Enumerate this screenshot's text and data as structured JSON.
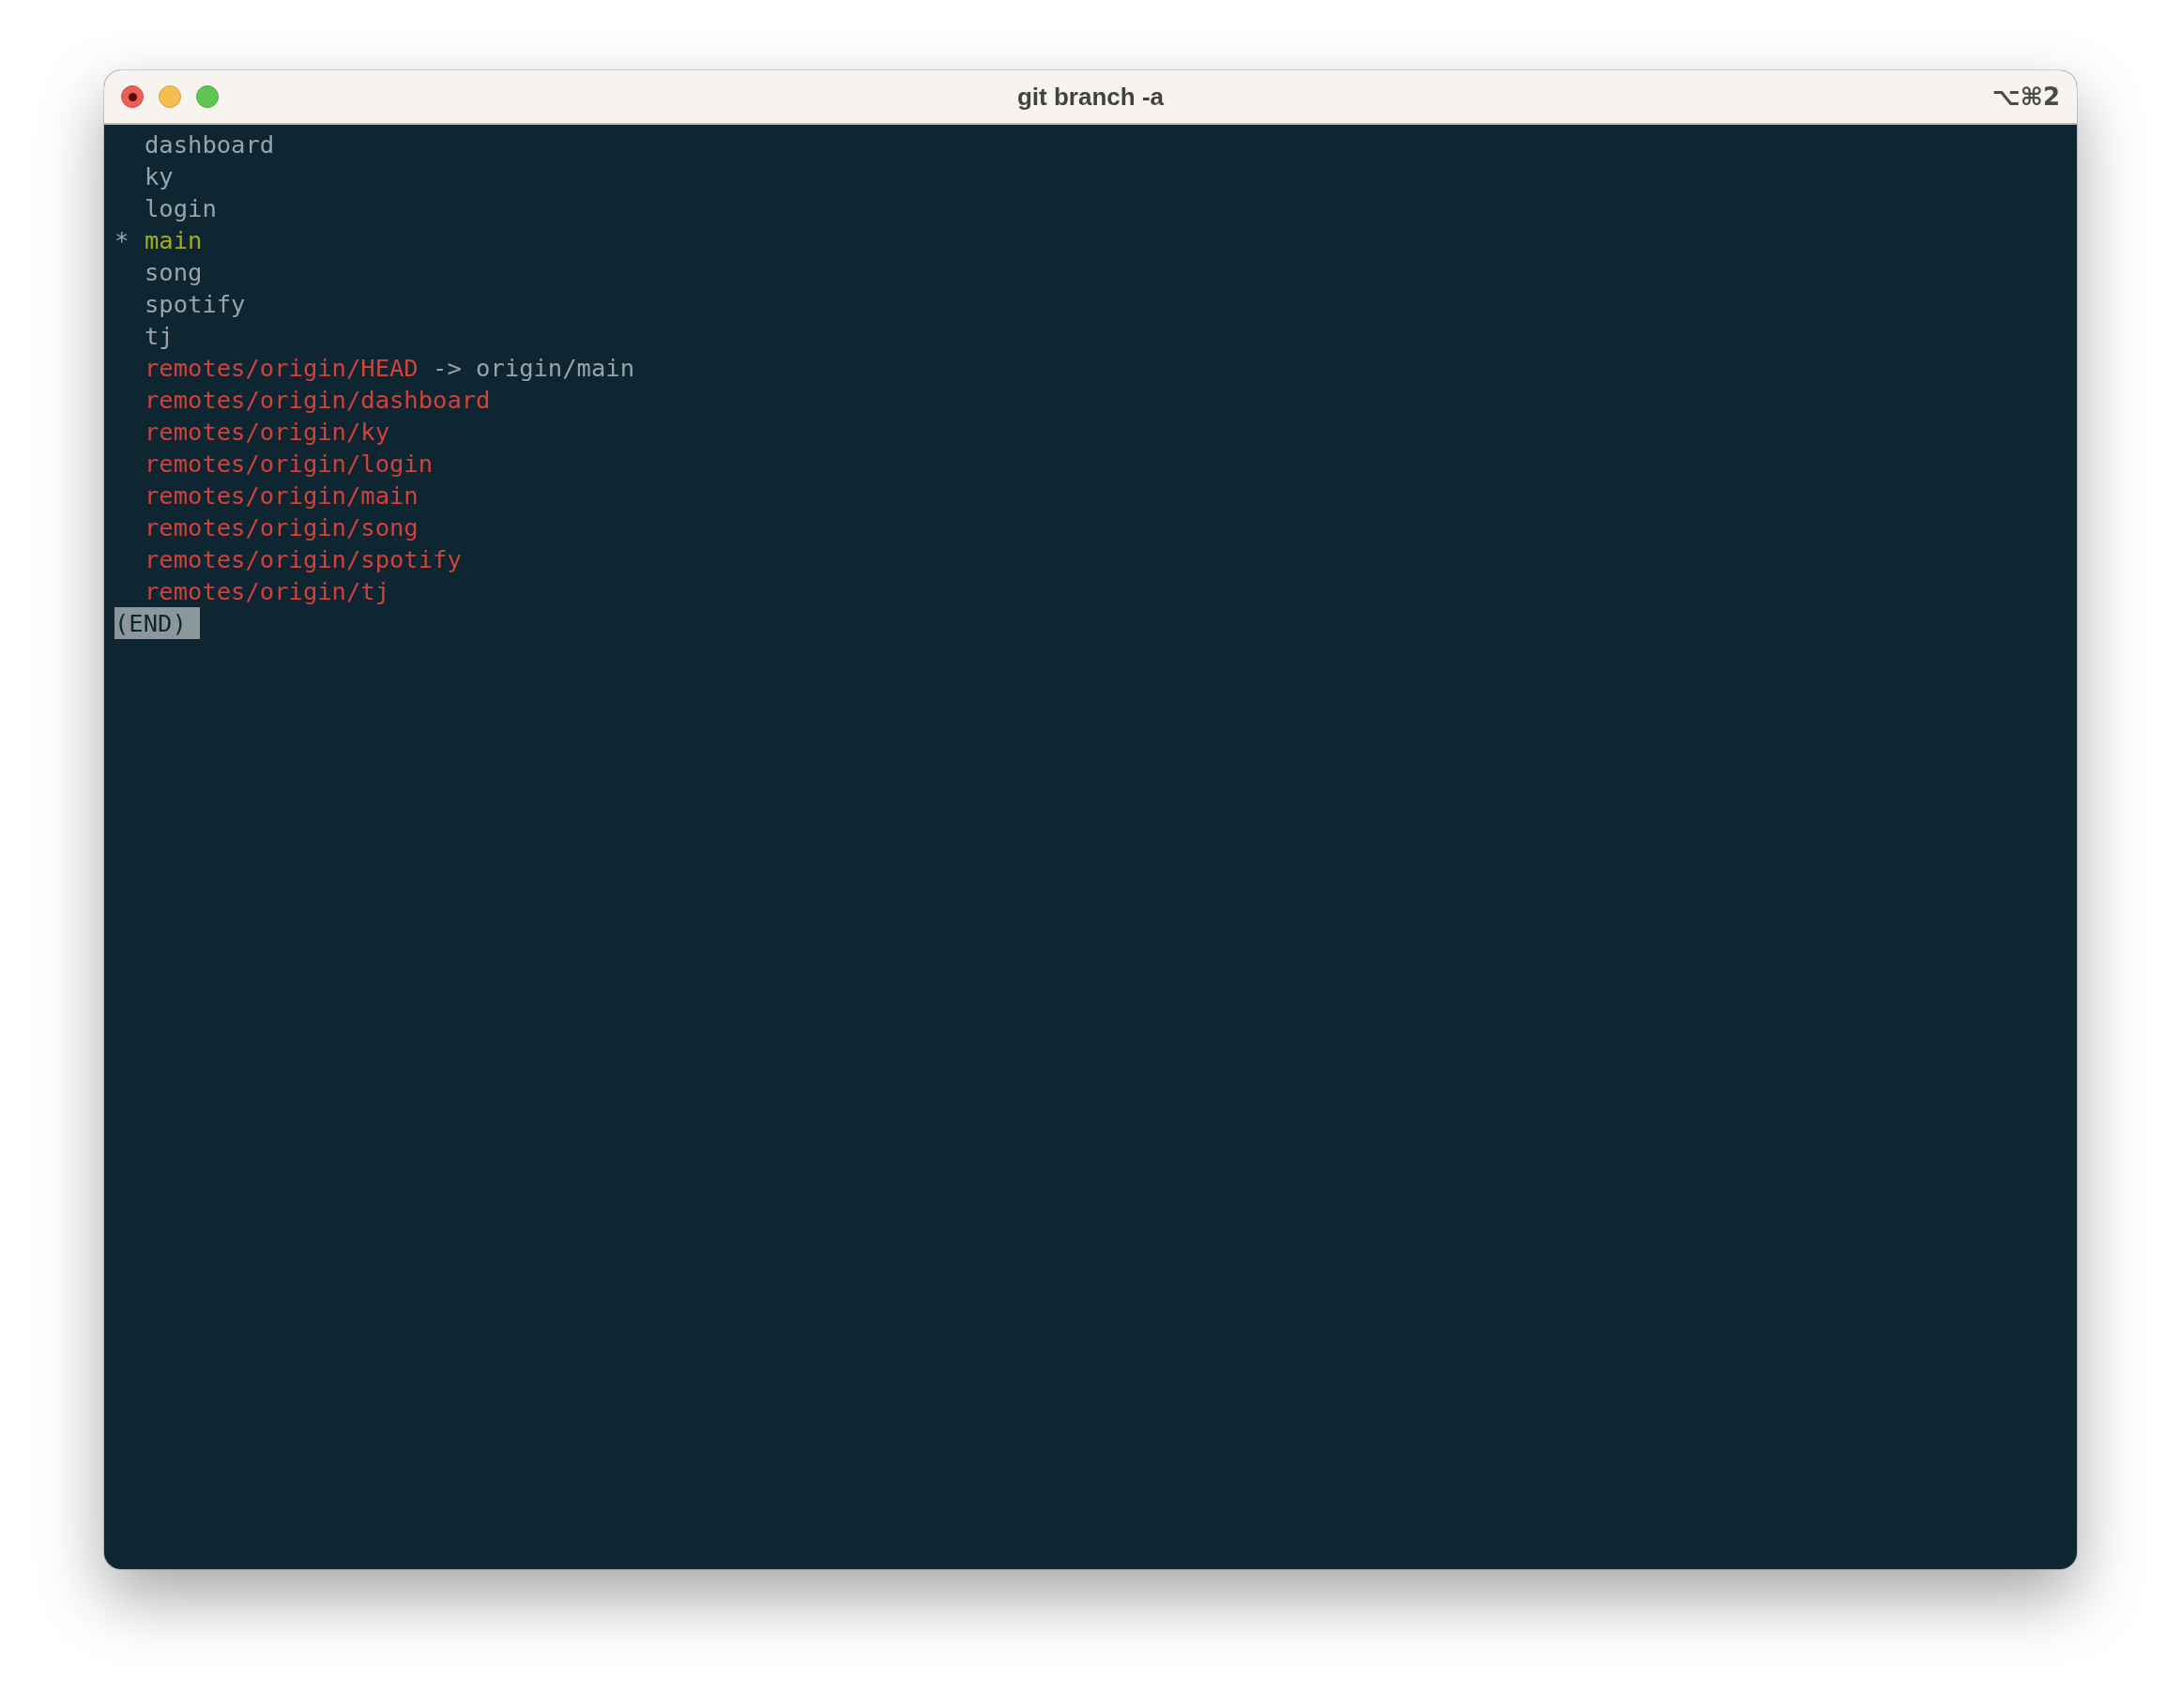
{
  "window": {
    "title": "git branch -a",
    "shortcut": "⌥⌘2"
  },
  "terminal": {
    "lines": [
      {
        "kind": "local",
        "name": "dashboard",
        "current": false
      },
      {
        "kind": "local",
        "name": "ky",
        "current": false
      },
      {
        "kind": "local",
        "name": "login",
        "current": false
      },
      {
        "kind": "local",
        "name": "main",
        "current": true,
        "marker": "*"
      },
      {
        "kind": "local",
        "name": "song",
        "current": false
      },
      {
        "kind": "local",
        "name": "spotify",
        "current": false
      },
      {
        "kind": "local",
        "name": "tj",
        "current": false
      },
      {
        "kind": "remote",
        "name": "remotes/origin/HEAD",
        "pointer": "-> origin/main"
      },
      {
        "kind": "remote",
        "name": "remotes/origin/dashboard"
      },
      {
        "kind": "remote",
        "name": "remotes/origin/ky"
      },
      {
        "kind": "remote",
        "name": "remotes/origin/login"
      },
      {
        "kind": "remote",
        "name": "remotes/origin/main"
      },
      {
        "kind": "remote",
        "name": "remotes/origin/song"
      },
      {
        "kind": "remote",
        "name": "remotes/origin/spotify"
      },
      {
        "kind": "remote",
        "name": "remotes/origin/tj"
      },
      {
        "kind": "pager",
        "text": "(END)"
      }
    ]
  }
}
